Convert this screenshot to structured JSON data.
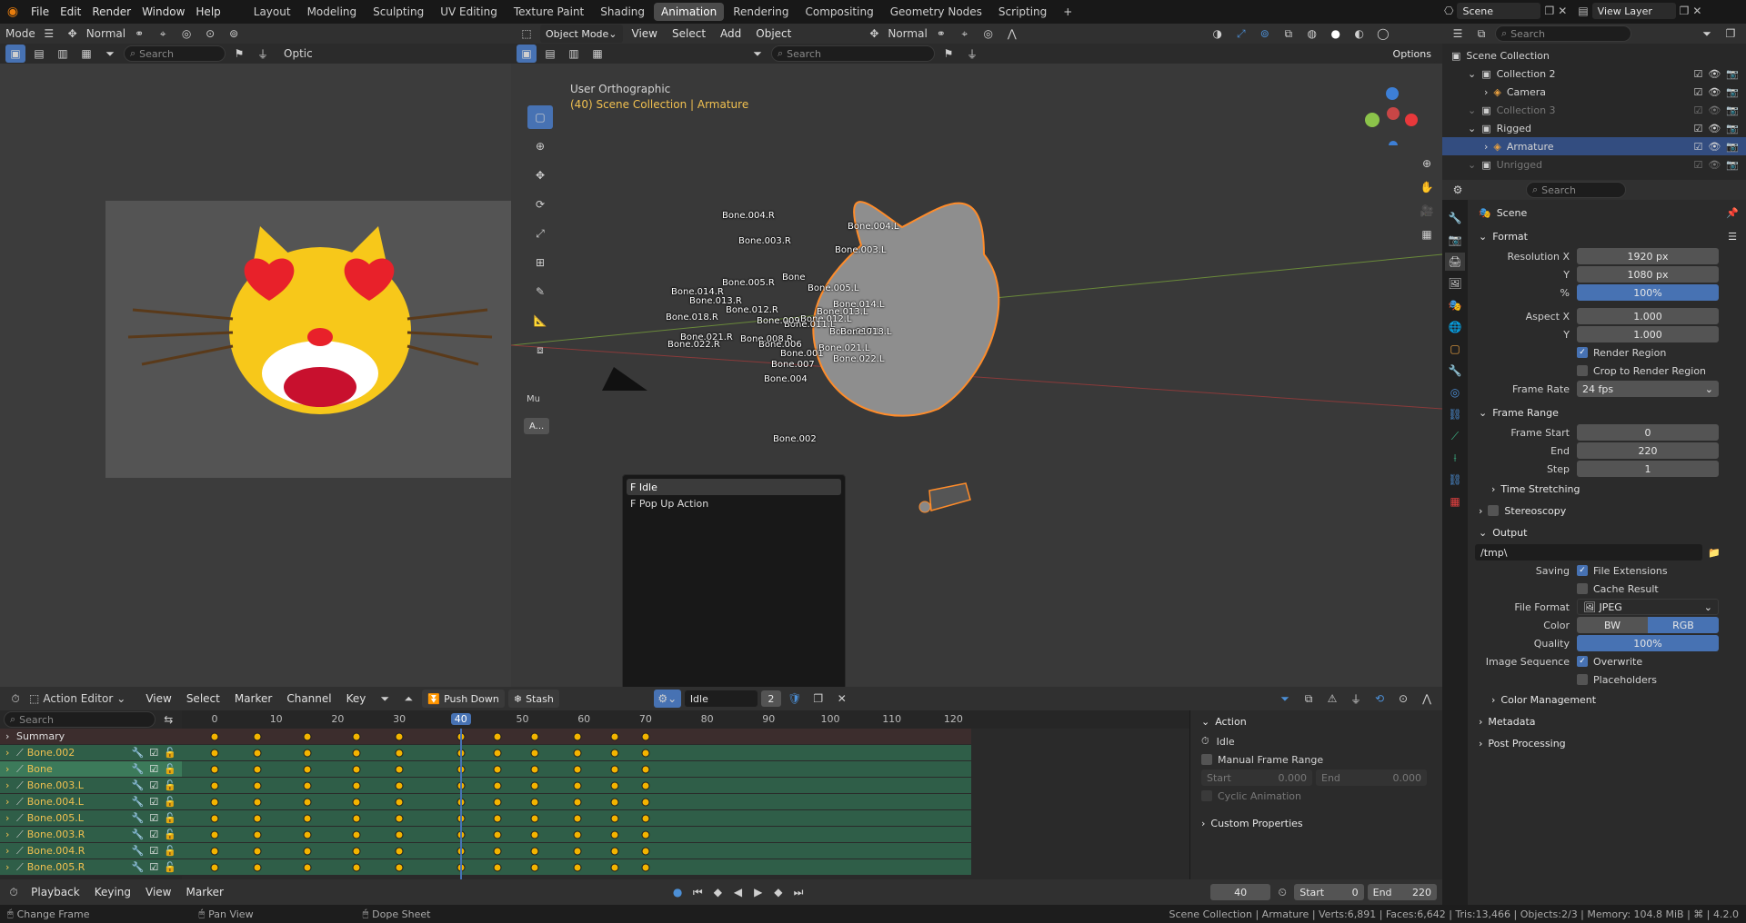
{
  "topbar": {
    "menus": [
      "File",
      "Edit",
      "Render",
      "Window",
      "Help"
    ],
    "workspaces": [
      "Layout",
      "Modeling",
      "Sculpting",
      "UV Editing",
      "Texture Paint",
      "Shading",
      "Animation",
      "Rendering",
      "Compositing",
      "Geometry Nodes",
      "Scripting"
    ],
    "active_workspace": "Animation",
    "add_tab": "+",
    "scene": "Scene",
    "view_layer": "View Layer"
  },
  "left_view": {
    "mode": "Mode",
    "normal": "Normal",
    "search_placeholder": "Search",
    "options": "Optic"
  },
  "viewport": {
    "mode": "Object Mode",
    "menus": [
      "View",
      "Select",
      "Add",
      "Object"
    ],
    "normal": "Normal",
    "search_placeholder": "Search",
    "options": "Options",
    "view_name": "User Orthographic",
    "collection_info": "(40) Scene Collection | Armature",
    "mu_label": "Mu",
    "a_label": "A..."
  },
  "bones": [
    "Bone.004.R",
    "Bone.004.L",
    "Bone.003.R",
    "Bone.003.L",
    "Bone.005.R",
    "Bone",
    "Bone.005.L",
    "Bone.014.R",
    "Bone.013.R",
    "Bone.012.R",
    "Bone.018.R",
    "Bone.014.L",
    "Bone.013.L",
    "Bone.012.L",
    "Bone.011.L",
    "Bone.017.L",
    "Bone.018.L",
    "Bone.009",
    "Bone.021.R",
    "Bone.022.R",
    "Bone.008.R",
    "Bone.021.L",
    "Bone.006",
    "Bone.001",
    "Bone.007",
    "Bone.022.L",
    "Bone.004",
    "Bone.002"
  ],
  "popup": {
    "items": [
      "F Idle",
      "F Pop Up Action"
    ],
    "search_value": ""
  },
  "outliner": {
    "search_placeholder": "Search",
    "root": "Scene Collection",
    "items": [
      {
        "name": "Collection 2",
        "level": 1
      },
      {
        "name": "Camera",
        "level": 2
      },
      {
        "name": "Collection 3",
        "level": 1
      },
      {
        "name": "Rigged",
        "level": 1
      },
      {
        "name": "Armature",
        "level": 2
      },
      {
        "name": "Unrigged",
        "level": 1
      }
    ]
  },
  "properties": {
    "search_placeholder": "Search",
    "scene": "Scene",
    "format": {
      "title": "Format",
      "res_x_label": "Resolution X",
      "res_x": "1920 px",
      "y_label": "Y",
      "res_y": "1080 px",
      "pct_label": "%",
      "pct": "100%",
      "aspect_x_label": "Aspect X",
      "aspect_x": "1.000",
      "aspect_y": "1.000",
      "render_region": "Render Region",
      "crop": "Crop to Render Region",
      "fps_label": "Frame Rate",
      "fps": "24 fps"
    },
    "frame_range": {
      "title": "Frame Range",
      "start_label": "Frame Start",
      "start": "0",
      "end_label": "End",
      "end": "220",
      "step_label": "Step",
      "step": "1",
      "time_stretching": "Time Stretching"
    },
    "stereoscopy": "Stereoscopy",
    "output": {
      "title": "Output",
      "path": "/tmp\\",
      "saving_label": "Saving",
      "file_ext": "File Extensions",
      "cache": "Cache Result",
      "format_label": "File Format",
      "format": "JPEG",
      "color_label": "Color",
      "bw": "BW",
      "rgb": "RGB",
      "quality_label": "Quality",
      "quality": "100%",
      "seq_label": "Image Sequence",
      "overwrite": "Overwrite",
      "placeholders": "Placeholders",
      "color_mgmt": "Color Management"
    },
    "metadata": "Metadata",
    "post": "Post Processing"
  },
  "action_editor": {
    "mode": "Action Editor",
    "menus": [
      "View",
      "Select",
      "Marker",
      "Channel",
      "Key"
    ],
    "push_down": "Push Down",
    "stash": "Stash",
    "action": "Idle",
    "users": "2",
    "search_placeholder": "Search",
    "ticks": [
      "0",
      "10",
      "20",
      "30",
      "40",
      "50",
      "60",
      "70",
      "80",
      "90",
      "100",
      "110",
      "120"
    ],
    "current_frame": "40",
    "channels": [
      "Summary",
      "Bone.002",
      "Bone",
      "Bone.003.L",
      "Bone.004.L",
      "Bone.005.L",
      "Bone.003.R",
      "Bone.004.R",
      "Bone.005.R"
    ],
    "keyframes": [
      0,
      7,
      15,
      23,
      30,
      40,
      46,
      52,
      59,
      65,
      70
    ],
    "side": {
      "title": "Action",
      "action": "Idle",
      "manual_range": "Manual Frame Range",
      "start_label": "Start",
      "start": "0.000",
      "end_label": "End",
      "end": "0.000",
      "cyclic": "Cyclic Animation",
      "custom": "Custom Properties"
    }
  },
  "timeline": {
    "menus": [
      "Playback",
      "Keying",
      "View",
      "Marker"
    ],
    "frame": "40",
    "start_label": "Start",
    "start": "0",
    "end_label": "End",
    "end": "220"
  },
  "status": {
    "change_frame": "Change Frame",
    "pan_view": "Pan View",
    "dope_sheet": "Dope Sheet",
    "stats": "Scene Collection | Armature | Verts:6,891 | Faces:6,642 | Tris:13,466 | Objects:2/3 | Memory: 104.8 MiB | ⌘ | 4.2.0"
  },
  "colors": {
    "accent": "#4772b3",
    "keyframe": "#f3b400",
    "selection": "#ff8c2a"
  }
}
